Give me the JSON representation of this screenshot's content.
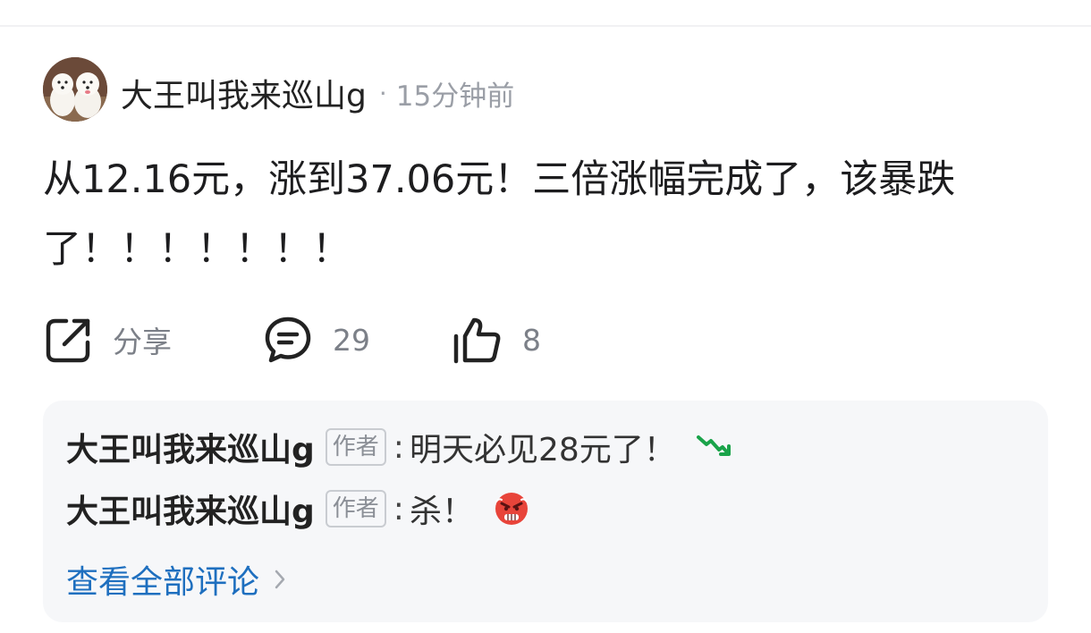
{
  "post": {
    "author": "大王叫我来巡山g",
    "separator": "·",
    "time": "15分钟前",
    "text": "从12.16元，涨到37.06元！三倍涨幅完成了，该暴跌了！！！！！！！"
  },
  "actions": {
    "share_label": "分享",
    "comment_count": "29",
    "like_count": "8",
    "icon_share": "share-icon",
    "icon_comment": "comment-icon",
    "icon_like": "thumbs-up-icon"
  },
  "comments": [
    {
      "user": "大王叫我来巡山g",
      "badge": "作者",
      "colon": ":",
      "text": "明天必见28元了！",
      "emoji": "falling-green-chart-icon"
    },
    {
      "user": "大王叫我来巡山g",
      "badge": "作者",
      "colon": ":",
      "text": "杀！",
      "emoji": "angry-face-icon"
    }
  ],
  "view_all_label": "查看全部评论",
  "colors": {
    "link": "#1e6fbf",
    "muted": "#9a9ea6",
    "stock_down": "#1aa34a",
    "angry_red": "#e8443a"
  }
}
